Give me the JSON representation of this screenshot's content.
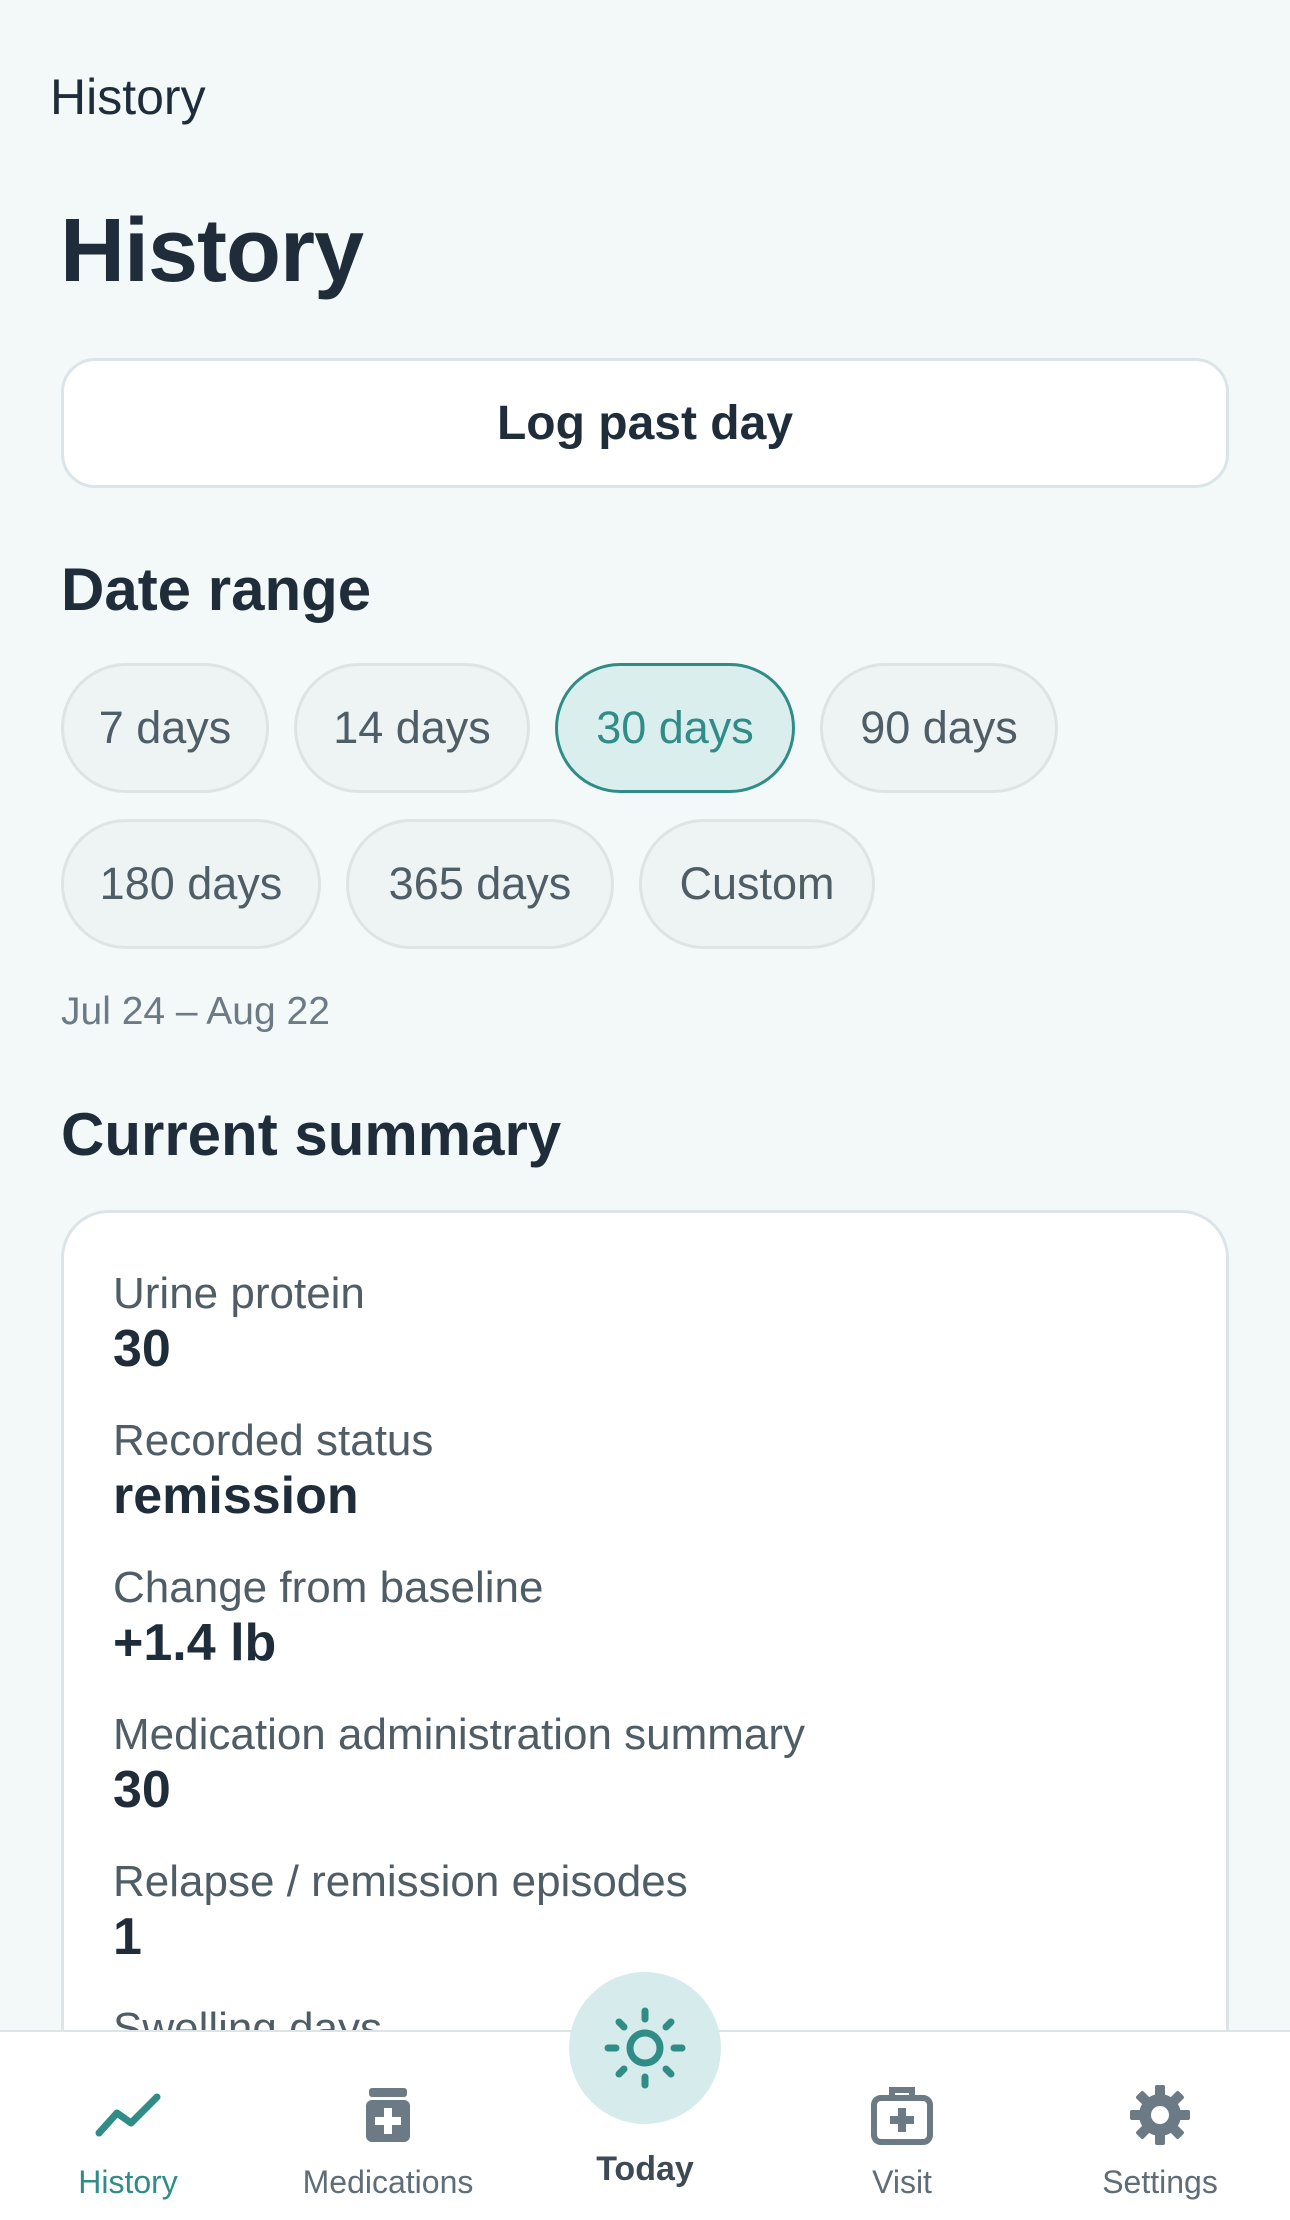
{
  "header": {
    "nav_title": "History",
    "page_title": "History"
  },
  "actions": {
    "log_past_day": "Log past day"
  },
  "date_range": {
    "title": "Date range",
    "options": [
      "7 days",
      "14 days",
      "30 days",
      "90 days",
      "180 days",
      "365 days",
      "Custom"
    ],
    "selected": "30 days",
    "range_text": "Jul 24 – Aug 22"
  },
  "summary": {
    "title": "Current summary",
    "items": [
      {
        "label": "Urine protein",
        "value": "30"
      },
      {
        "label": "Recorded status",
        "value": "remission"
      },
      {
        "label": "Change from baseline",
        "value": "+1.4 lb"
      },
      {
        "label": "Medication administration summary",
        "value": "30"
      },
      {
        "label": "Relapse / remission episodes",
        "value": "1"
      },
      {
        "label": "Swelling days",
        "value": ""
      }
    ]
  },
  "tabbar": {
    "items": [
      {
        "label": "History",
        "icon": "trend-line-icon",
        "active": true
      },
      {
        "label": "Medications",
        "icon": "pill-bottle-icon",
        "active": false
      },
      {
        "label": "Today",
        "icon": "sun-icon",
        "active": false
      },
      {
        "label": "Visit",
        "icon": "medical-bag-icon",
        "active": false
      },
      {
        "label": "Settings",
        "icon": "gear-icon",
        "active": false
      }
    ]
  },
  "colors": {
    "accent": "#2f8c87",
    "background": "#f3f8f9",
    "text": "#1f2d3a",
    "muted": "#6b7a84"
  }
}
